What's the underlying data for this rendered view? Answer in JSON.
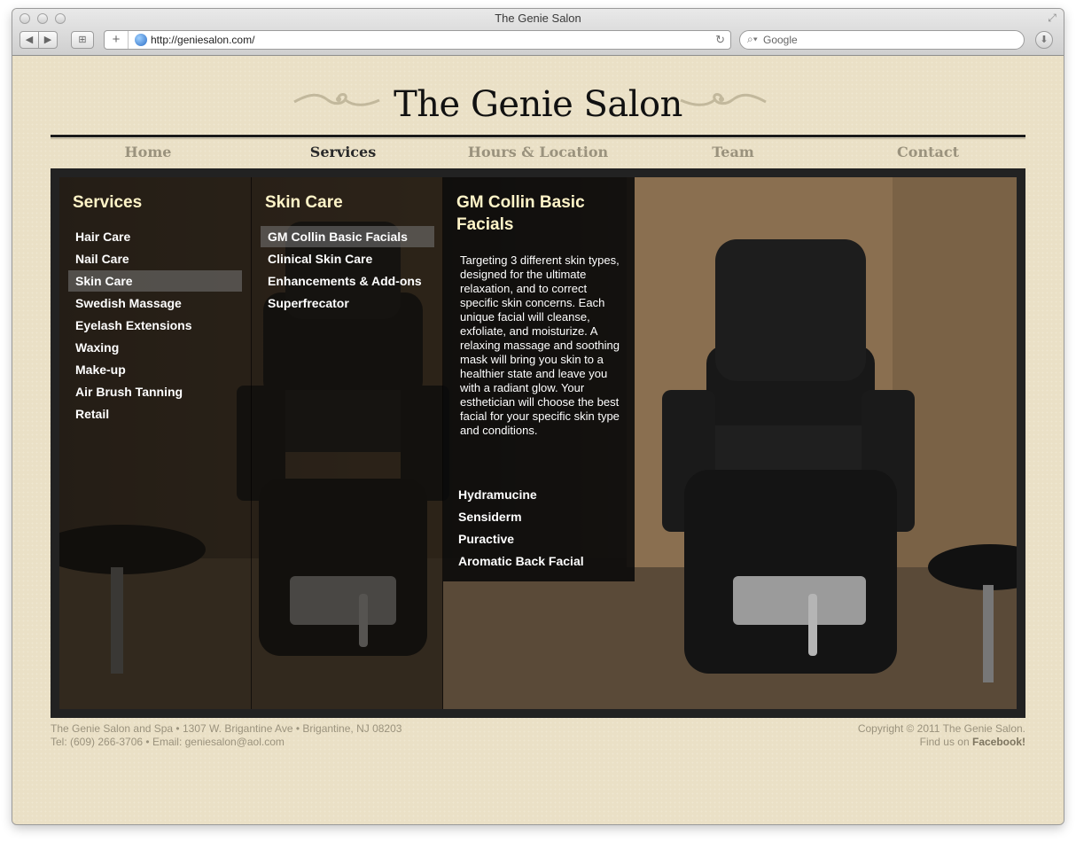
{
  "browser": {
    "window_title": "The Genie Salon",
    "url": "http://geniesalon.com/",
    "search_placeholder": "Google"
  },
  "site": {
    "logo": "The Genie Salon",
    "nav": [
      "Home",
      "Services",
      "Hours & Location",
      "Team",
      "Contact"
    ],
    "active_nav": "Services"
  },
  "menu": {
    "col1": {
      "title": "Services",
      "items": [
        "Hair Care",
        "Nail Care",
        "Skin Care",
        "Swedish Massage",
        "Eyelash Extensions",
        "Waxing",
        "Make-up",
        "Air Brush Tanning",
        "Retail"
      ],
      "selected": "Skin Care"
    },
    "col2": {
      "title": "Skin Care",
      "items": [
        "GM Collin Basic Facials",
        "Clinical Skin Care",
        "Enhancements & Add-ons",
        "Superfrecator"
      ],
      "selected": "GM Collin Basic Facials"
    },
    "col3": {
      "title_line1": "GM Collin Basic",
      "title_line2": "Facials",
      "description": "Targeting 3 different skin types, designed for the ultimate relaxation, and to correct specific skin concerns. Each unique facial will cleanse, exfoliate, and moisturize. A relaxing massage and soothing mask will bring you skin to a healthier state and leave you with a radiant glow. Your esthetician will choose the best facial for your specific skin type and conditions.",
      "items": [
        "Hydramucine",
        "Sensiderm",
        "Puractive",
        "Aromatic Back Facial"
      ]
    }
  },
  "footer": {
    "address": "The Genie Salon and Spa • 1307 W. Brigantine Ave • Brigantine, NJ 08203",
    "contact": "Tel: (609) 266-3706 • Email: geniesalon@aol.com",
    "copyright": "Copyright © 2011 The Genie Salon.",
    "social_prefix": "Find us on ",
    "social_link": "Facebook!"
  },
  "colors": {
    "page_background": "#eae0c6",
    "nav_active": "#2a2a2a",
    "nav_inactive": "#9a927d",
    "menu_heading": "#fff4c8"
  }
}
